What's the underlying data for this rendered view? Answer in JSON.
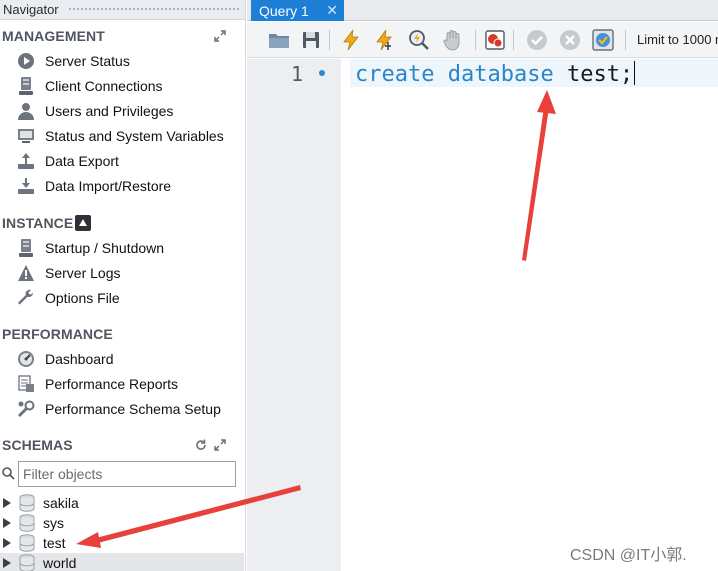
{
  "navigator": {
    "title": "Navigator",
    "sections": {
      "management": {
        "title": "MANAGEMENT",
        "items": [
          {
            "label": "Server Status",
            "icon": "play-circle-icon"
          },
          {
            "label": "Client Connections",
            "icon": "server-icon"
          },
          {
            "label": "Users and Privileges",
            "icon": "user-icon"
          },
          {
            "label": "Status and System Variables",
            "icon": "monitor-icon"
          },
          {
            "label": "Data Export",
            "icon": "export-icon"
          },
          {
            "label": "Data Import/Restore",
            "icon": "import-icon"
          }
        ]
      },
      "instance": {
        "title": "INSTANCE",
        "items": [
          {
            "label": "Startup / Shutdown",
            "icon": "server-icon"
          },
          {
            "label": "Server Logs",
            "icon": "warning-icon"
          },
          {
            "label": "Options File",
            "icon": "wrench-icon"
          }
        ]
      },
      "performance": {
        "title": "PERFORMANCE",
        "items": [
          {
            "label": "Dashboard",
            "icon": "dashboard-icon"
          },
          {
            "label": "Performance Reports",
            "icon": "reports-icon"
          },
          {
            "label": "Performance Schema Setup",
            "icon": "tools-icon"
          }
        ]
      },
      "schemas": {
        "title": "SCHEMAS",
        "filter_placeholder": "Filter objects",
        "items": [
          "sakila",
          "sys",
          "test",
          "world"
        ]
      }
    }
  },
  "tabs": [
    {
      "label": "Query 1",
      "active": true
    }
  ],
  "toolbar": {
    "limit_label": "Limit to 1000 r"
  },
  "editor": {
    "line_number": "1",
    "code": {
      "kw1": "create",
      "kw2": "database",
      "ident": "test;"
    }
  },
  "watermark": "CSDN @IT小郭.",
  "colors": {
    "accent": "#1d7fd6",
    "keyword": "#2a86c9",
    "annotation_arrow": "#e8413c"
  }
}
